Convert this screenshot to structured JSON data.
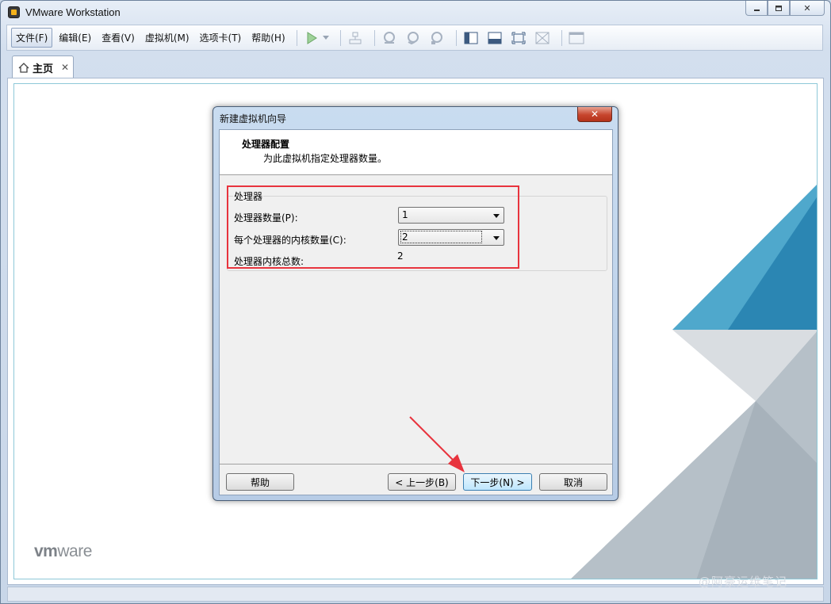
{
  "window": {
    "title": "VMware Workstation",
    "controls": {
      "minimize": "▭",
      "restore": "⧉",
      "close": "✕"
    }
  },
  "menu": {
    "items": [
      "文件(F)",
      "编辑(E)",
      "查看(V)",
      "虚拟机(M)",
      "选项卡(T)",
      "帮助(H)"
    ]
  },
  "tab": {
    "label": "主页",
    "close": "✕"
  },
  "brand": {
    "vm": "vm",
    "ware": "ware"
  },
  "watermark": "@阿豪运维笔记",
  "dialog": {
    "title": "新建虚拟机向导",
    "close": "✕",
    "heading": "处理器配置",
    "subheading": "为此虚拟机指定处理器数量。",
    "group_title": "处理器",
    "rows": {
      "processor_count_label": "处理器数量(P):",
      "processor_count_value": "1",
      "cores_per_processor_label": "每个处理器的内核数量(C):",
      "cores_per_processor_value": "2",
      "total_cores_label": "处理器内核总数:",
      "total_cores_value": "2"
    },
    "buttons": {
      "help": "帮助",
      "back": "< 上一步(B)",
      "next": "下一步(N) >",
      "cancel": "取消"
    }
  },
  "colors": {
    "highlight": "#e8343e",
    "accent_blue": "#1e7fb0",
    "art_gray": "#b6c0c8"
  },
  "toolbar_icons": [
    "play-icon",
    "dropdown-arrow-icon",
    "snapshot-network-icon",
    "snapshot-take-icon",
    "snapshot-revert-icon",
    "snapshot-manager-icon",
    "show-library-icon",
    "console-view-icon",
    "full-screen-icon",
    "unity-icon",
    "thumbnail-icon"
  ]
}
